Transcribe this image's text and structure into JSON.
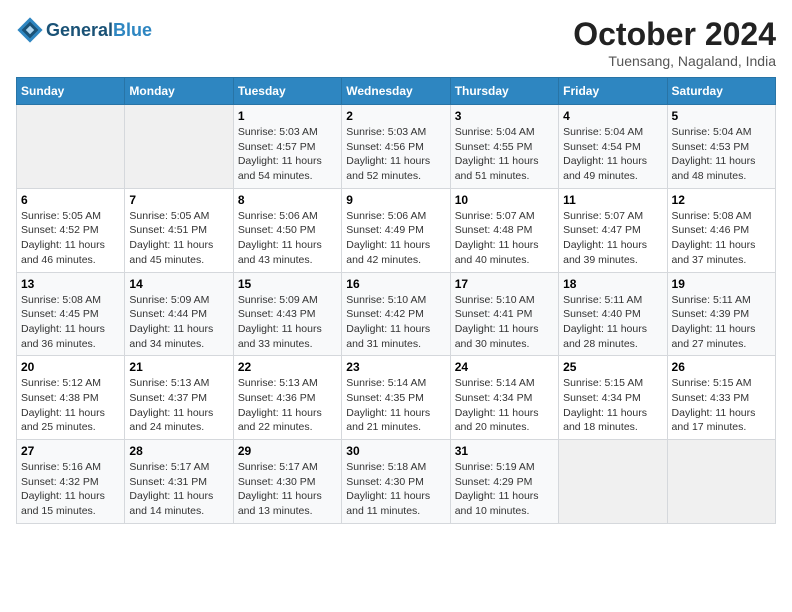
{
  "header": {
    "logo_general": "General",
    "logo_blue": "Blue",
    "month_title": "October 2024",
    "location": "Tuensang, Nagaland, India"
  },
  "calendar": {
    "days_of_week": [
      "Sunday",
      "Monday",
      "Tuesday",
      "Wednesday",
      "Thursday",
      "Friday",
      "Saturday"
    ],
    "weeks": [
      [
        {
          "day": "",
          "info": ""
        },
        {
          "day": "",
          "info": ""
        },
        {
          "day": "1",
          "info": "Sunrise: 5:03 AM\nSunset: 4:57 PM\nDaylight: 11 hours and 54 minutes."
        },
        {
          "day": "2",
          "info": "Sunrise: 5:03 AM\nSunset: 4:56 PM\nDaylight: 11 hours and 52 minutes."
        },
        {
          "day": "3",
          "info": "Sunrise: 5:04 AM\nSunset: 4:55 PM\nDaylight: 11 hours and 51 minutes."
        },
        {
          "day": "4",
          "info": "Sunrise: 5:04 AM\nSunset: 4:54 PM\nDaylight: 11 hours and 49 minutes."
        },
        {
          "day": "5",
          "info": "Sunrise: 5:04 AM\nSunset: 4:53 PM\nDaylight: 11 hours and 48 minutes."
        }
      ],
      [
        {
          "day": "6",
          "info": "Sunrise: 5:05 AM\nSunset: 4:52 PM\nDaylight: 11 hours and 46 minutes."
        },
        {
          "day": "7",
          "info": "Sunrise: 5:05 AM\nSunset: 4:51 PM\nDaylight: 11 hours and 45 minutes."
        },
        {
          "day": "8",
          "info": "Sunrise: 5:06 AM\nSunset: 4:50 PM\nDaylight: 11 hours and 43 minutes."
        },
        {
          "day": "9",
          "info": "Sunrise: 5:06 AM\nSunset: 4:49 PM\nDaylight: 11 hours and 42 minutes."
        },
        {
          "day": "10",
          "info": "Sunrise: 5:07 AM\nSunset: 4:48 PM\nDaylight: 11 hours and 40 minutes."
        },
        {
          "day": "11",
          "info": "Sunrise: 5:07 AM\nSunset: 4:47 PM\nDaylight: 11 hours and 39 minutes."
        },
        {
          "day": "12",
          "info": "Sunrise: 5:08 AM\nSunset: 4:46 PM\nDaylight: 11 hours and 37 minutes."
        }
      ],
      [
        {
          "day": "13",
          "info": "Sunrise: 5:08 AM\nSunset: 4:45 PM\nDaylight: 11 hours and 36 minutes."
        },
        {
          "day": "14",
          "info": "Sunrise: 5:09 AM\nSunset: 4:44 PM\nDaylight: 11 hours and 34 minutes."
        },
        {
          "day": "15",
          "info": "Sunrise: 5:09 AM\nSunset: 4:43 PM\nDaylight: 11 hours and 33 minutes."
        },
        {
          "day": "16",
          "info": "Sunrise: 5:10 AM\nSunset: 4:42 PM\nDaylight: 11 hours and 31 minutes."
        },
        {
          "day": "17",
          "info": "Sunrise: 5:10 AM\nSunset: 4:41 PM\nDaylight: 11 hours and 30 minutes."
        },
        {
          "day": "18",
          "info": "Sunrise: 5:11 AM\nSunset: 4:40 PM\nDaylight: 11 hours and 28 minutes."
        },
        {
          "day": "19",
          "info": "Sunrise: 5:11 AM\nSunset: 4:39 PM\nDaylight: 11 hours and 27 minutes."
        }
      ],
      [
        {
          "day": "20",
          "info": "Sunrise: 5:12 AM\nSunset: 4:38 PM\nDaylight: 11 hours and 25 minutes."
        },
        {
          "day": "21",
          "info": "Sunrise: 5:13 AM\nSunset: 4:37 PM\nDaylight: 11 hours and 24 minutes."
        },
        {
          "day": "22",
          "info": "Sunrise: 5:13 AM\nSunset: 4:36 PM\nDaylight: 11 hours and 22 minutes."
        },
        {
          "day": "23",
          "info": "Sunrise: 5:14 AM\nSunset: 4:35 PM\nDaylight: 11 hours and 21 minutes."
        },
        {
          "day": "24",
          "info": "Sunrise: 5:14 AM\nSunset: 4:34 PM\nDaylight: 11 hours and 20 minutes."
        },
        {
          "day": "25",
          "info": "Sunrise: 5:15 AM\nSunset: 4:34 PM\nDaylight: 11 hours and 18 minutes."
        },
        {
          "day": "26",
          "info": "Sunrise: 5:15 AM\nSunset: 4:33 PM\nDaylight: 11 hours and 17 minutes."
        }
      ],
      [
        {
          "day": "27",
          "info": "Sunrise: 5:16 AM\nSunset: 4:32 PM\nDaylight: 11 hours and 15 minutes."
        },
        {
          "day": "28",
          "info": "Sunrise: 5:17 AM\nSunset: 4:31 PM\nDaylight: 11 hours and 14 minutes."
        },
        {
          "day": "29",
          "info": "Sunrise: 5:17 AM\nSunset: 4:30 PM\nDaylight: 11 hours and 13 minutes."
        },
        {
          "day": "30",
          "info": "Sunrise: 5:18 AM\nSunset: 4:30 PM\nDaylight: 11 hours and 11 minutes."
        },
        {
          "day": "31",
          "info": "Sunrise: 5:19 AM\nSunset: 4:29 PM\nDaylight: 11 hours and 10 minutes."
        },
        {
          "day": "",
          "info": ""
        },
        {
          "day": "",
          "info": ""
        }
      ]
    ]
  }
}
